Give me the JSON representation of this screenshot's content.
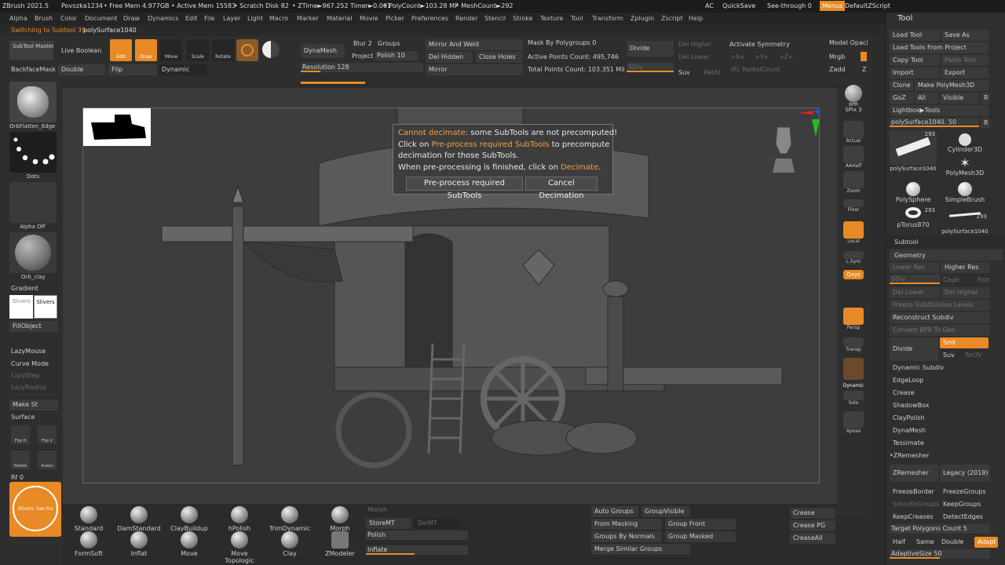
{
  "titlebar": {
    "app": "ZBrush 2021.5",
    "doc": "Povozka1234",
    "free_mem": "• Free Mem 4.977GB",
    "active_mem": "• Active Mem 15583",
    "scratch": "• Scratch Disk 82",
    "ztime": "• ZTime►967.252 Timer►0.001",
    "polycount": "• PolyCount►103.28 MP",
    "meshcount": "• MeshCount►292",
    "ac": "AC",
    "quicksave": "QuickSave",
    "seethrough": "See-through  0",
    "menus": "Menus",
    "default_zscript": "DefaultZScript"
  },
  "menubar": [
    "Alpha",
    "Brush",
    "Color",
    "Document",
    "Draw",
    "Dynamics",
    "Edit",
    "File",
    "Layer",
    "Light",
    "Macro",
    "Marker",
    "Material",
    "Movie",
    "Picker",
    "Preferences",
    "Render",
    "Stencil",
    "Stroke",
    "Texture",
    "Tool",
    "Transform",
    "Zplugin",
    "Zscript",
    "Help"
  ],
  "notebar": {
    "prefix": "Switching to Subtool 35:",
    "name": "polySurface1040"
  },
  "topshelf": {
    "subtool_master": "SubTool Master",
    "live_boolean": "Live Boolean",
    "edit": "Edit",
    "draw": "Draw",
    "move": "Move",
    "scale": "Scale",
    "rotate": "Rotate",
    "backface_mask": "BackfaceMask",
    "double": "Double",
    "flip": "Flip",
    "dynamic": "Dynamic",
    "dynamesh": "DynaMesh",
    "blur": "Blur 2",
    "groups": "Groups",
    "project": "Project",
    "polish": "Polish 10",
    "resolution": "Resolution 128",
    "mirror_weld": "Mirror And Weld",
    "del_hidden": "Del Hidden",
    "close_holes": "Close Holes",
    "mirror": "Mirror",
    "mask_by_polygroups": "Mask By Polygroups 0",
    "active_points": "Active Points Count: 495,746",
    "total_points": "Total Points Count: 103.351 Mil",
    "divide": "Divide",
    "del_higher": "Del Higher",
    "del_lower": "Del Lower",
    "sdiv": "SDiv",
    "suv": "Suv",
    "reuv": "ReUV",
    "activate_symmetry": "Activate Symmetry",
    "sym_x": ">X<",
    "sym_y": ">Y<",
    "sym_z": ">Z<",
    "radial_r": "(R)",
    "radial_count": "RadialCount",
    "model_opacity": "Model Opaci",
    "mrgb": "Mrgb",
    "zadd": "Zadd",
    "z": "Z",
    "fill_colors": {
      "accent": "#e88a25"
    }
  },
  "leftshelf": {
    "brush_label": "OrbFlatten_Edge",
    "stroke_label": "Dots",
    "alpha_label": "Alpha Off",
    "material_label": "Orb_clay",
    "gradient": "Gradient",
    "slivers_a": "Slivers",
    "slivers_b": "Slivers",
    "fill_object": "FillObject",
    "lazy_mouse": "LazyMouse",
    "curve_mode": "Curve Mode",
    "lazy_step": "LazyStep",
    "lazy_radius": "LazyRadius",
    "make_st": "Make St",
    "surface": "Surface",
    "flip_h": "Flip H",
    "flip_v": "Flip V",
    "rotate": "Rotate",
    "invers": "Invers",
    "rf": "Rf 0",
    "swatch_label": "Slivers: has tra"
  },
  "dialog": {
    "title_orange": "Cannot decimate:",
    "line1_rest": " some SubTools are not precomputed!",
    "line2_pre": "Click on ",
    "line2_orange": "Pre-process required SubTools",
    "line2_post": " to precompute",
    "line3": "decimation for those SubTools.",
    "line4_pre": "When pre-processing is finished, click on ",
    "line4_orange": "Decimate",
    "line4_post": ".",
    "btn_preprocess": "Pre-process required SubTools",
    "btn_cancel": "Cancel Decimation"
  },
  "rightshelf": {
    "bpr": "BPR",
    "spix": "SPix 3",
    "actual": "Actual",
    "aahalf": "AAHalf",
    "zoom": "Zoom",
    "floor": "Floor",
    "local": "Local",
    "lsym": "L.Sym",
    "xyz": "Qxyz",
    "persp": "Persp",
    "transp": "Transp",
    "dynamic": "Dynamic",
    "solo": "Solo",
    "xpose": "Xpose"
  },
  "bottom": {
    "brushes": [
      "Standard",
      "DamStandard",
      "ClayBuildup",
      "hPolish",
      "TrimDynamic",
      "Morph",
      "FormSoft",
      "Inflat",
      "Move",
      "Move Topologic",
      "Clay",
      "ZModeler"
    ],
    "morph": "Morph",
    "store_mt": "StoreMT",
    "del_mt": "DelMT",
    "polish": "Polish",
    "inflate": "Inflate",
    "auto_groups": "Auto Groups",
    "group_visible": "GroupVisible",
    "from_masking": "From Masking",
    "group_front": "Group Front",
    "groups_by_normals": "Groups By Normals",
    "group_masked": "Group Masked",
    "merge_similar": "Merge Similar Groups",
    "crease": "Crease",
    "crease_pg": "Crease PG",
    "crease_all": "CreaseAll"
  },
  "tray": {
    "title": "Tool",
    "load_tool": "Load Tool",
    "save_as": "Save As",
    "load_from_project": "Load Tools From Project",
    "copy_tool": "Copy Tool",
    "paste_tool": "Paste Tool",
    "import": "Import",
    "export": "Export",
    "clone": "Clone",
    "make_polymesh": "Make PolyMesh3D",
    "goz": "GoZ",
    "all": "All",
    "visible": "Visible",
    "r": "R",
    "lightbox_tools": "Lightbox▶Tools",
    "current_tool": "polySurface1040. 50",
    "thumbs": [
      {
        "label": "polySurface1040",
        "count": "293"
      },
      {
        "label": "Cylinder3D",
        "count": ""
      },
      {
        "label": "",
        "count": ""
      },
      {
        "label": "PolyMesh3D",
        "count": ""
      },
      {
        "label": "PolySphere",
        "count": ""
      },
      {
        "label": "SimpleBrush",
        "count": ""
      },
      {
        "label": "pTorus870",
        "count": "293"
      },
      {
        "label": "polySurface1040",
        "count": "293"
      }
    ],
    "subtool": "Subtool",
    "geometry": "Geometry",
    "lower_res": "Lower Res",
    "higher_res": "Higher Res",
    "sdiv": "SDiv",
    "cage": "Cage",
    "rstr": "Rstr",
    "del_lower": "Del Lower",
    "del_higher": "Del Higher",
    "freeze_subdiv": "Freeze SubDivision Levels",
    "reconstruct_subdiv": "Reconstruct Subdiv",
    "convert_bpr": "Convert BPR To Geo",
    "divide": "Divide",
    "smt": "Smt",
    "suv": "Suv",
    "reuv": "ReUV",
    "dynamic_subdiv": "Dynamic Subdiv",
    "edgeloop": "EdgeLoop",
    "crease": "Crease",
    "shadowbox": "ShadowBox",
    "claypolish": "ClayPolish",
    "dynamesh": "DynaMesh",
    "tessimate": "Tessimate",
    "zremesher_head": "•ZRemesher",
    "zremesher_btn": "ZRemesher",
    "legacy": "Legacy (2018)",
    "freeze_border": "FreezeBorder",
    "freeze_groups": "FreezeGroups",
    "smooth_groups": "SmoothGroups",
    "keep_groups": "KeepGroups",
    "keep_creases": "KeepCreases",
    "detect_edges": "DetectEdges",
    "target_polys": "Target Polygons Count 5",
    "half": "Half",
    "same": "Same",
    "double": "Double",
    "adapt": "Adapt",
    "adaptive_size": "AdaptiveSize 50"
  }
}
